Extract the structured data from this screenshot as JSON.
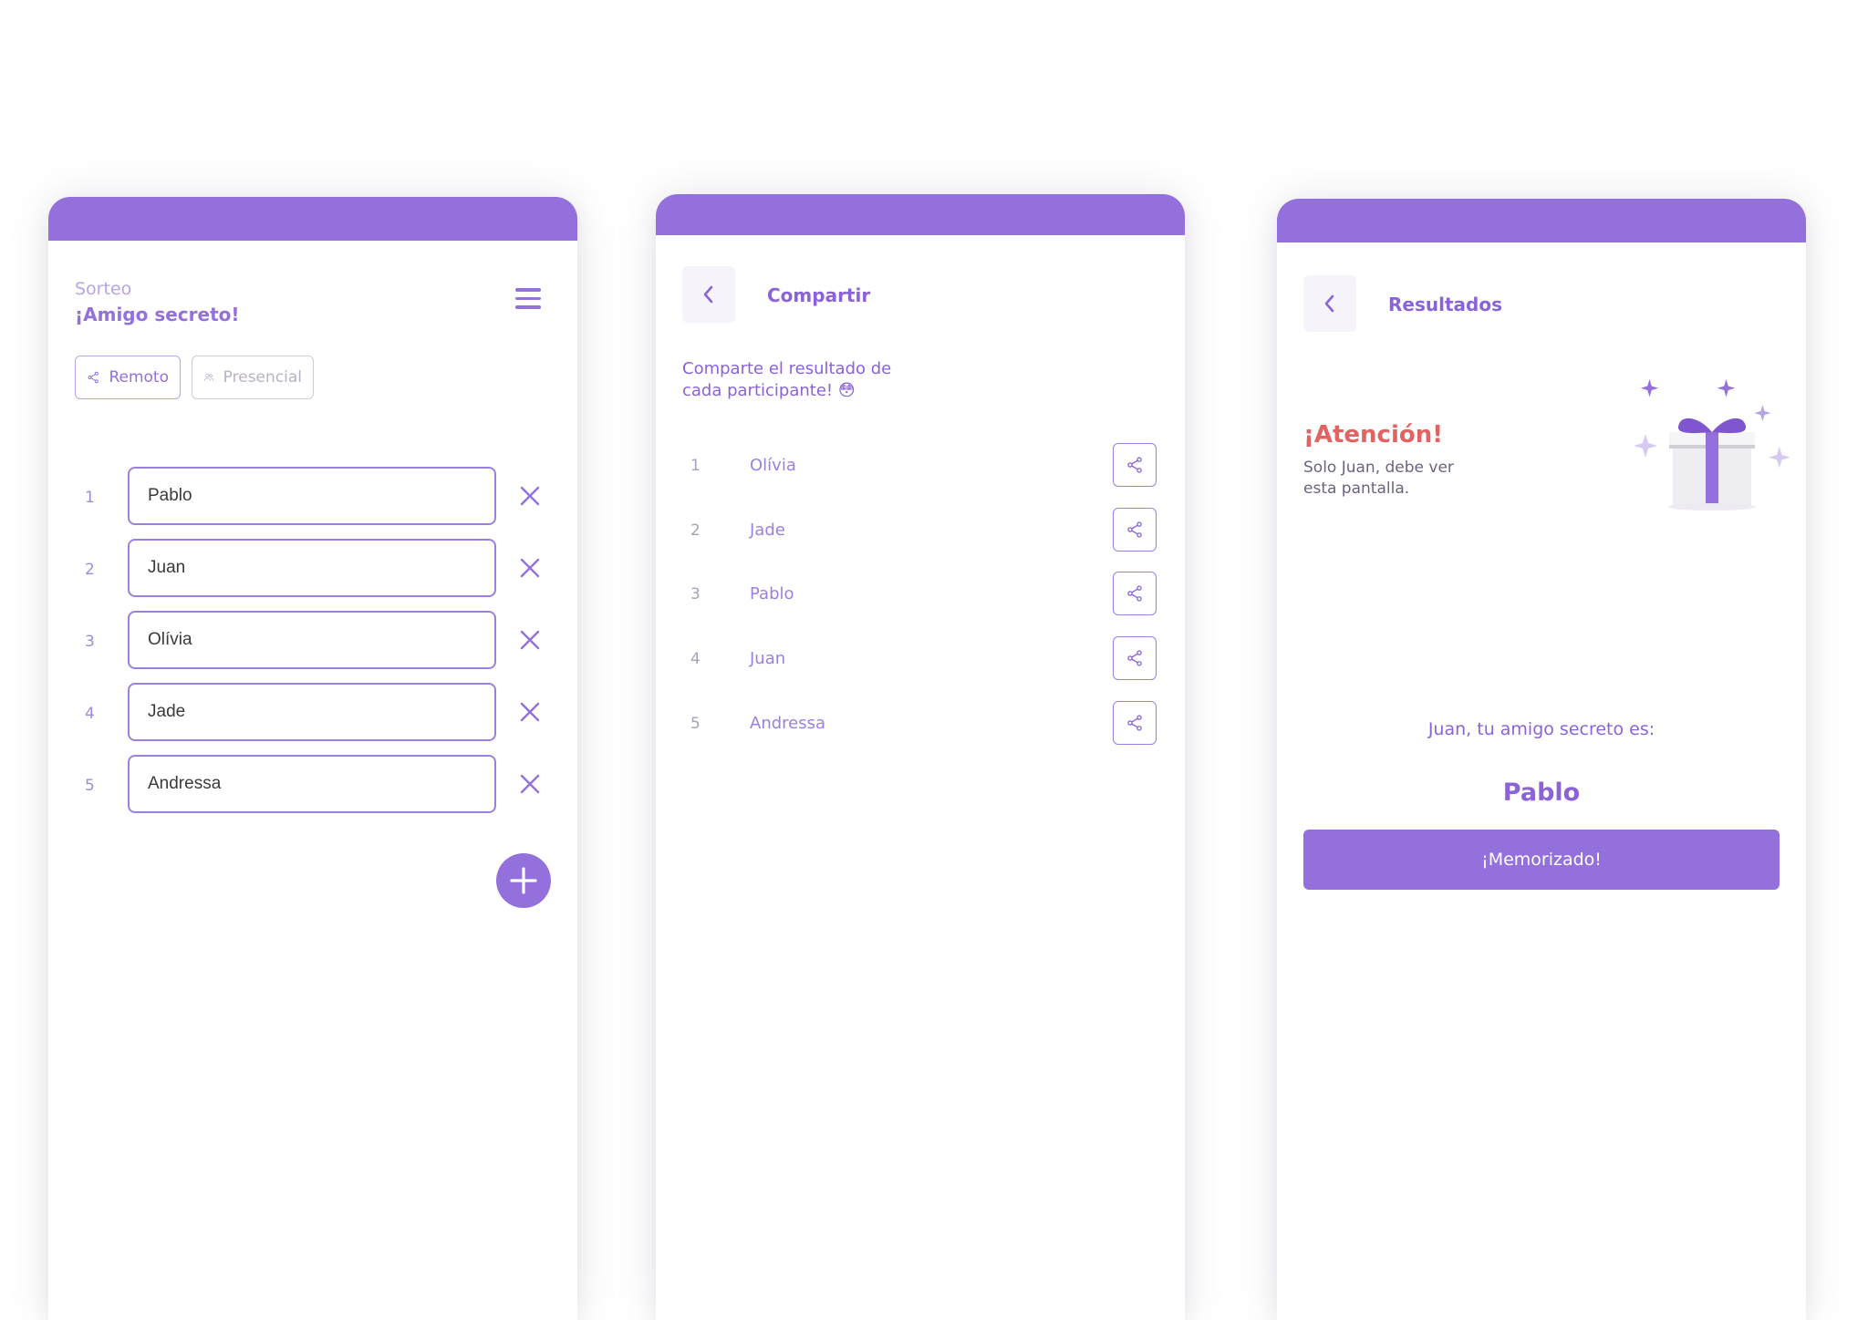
{
  "screen1": {
    "title_small": "Sorteo",
    "title": "¡Amigo secreto!",
    "menu_icon": "hamburger-menu-icon",
    "chips": [
      {
        "label": "Remoto",
        "icon": "share-icon"
      },
      {
        "label": "Presencial",
        "icon": "users-icon"
      }
    ],
    "participants": [
      {
        "num": "1",
        "value": "Pablo"
      },
      {
        "num": "2",
        "value": "Juan"
      },
      {
        "num": "3",
        "value": "Olívia"
      },
      {
        "num": "4",
        "value": "Jade"
      },
      {
        "num": "5",
        "value": "Andressa"
      }
    ],
    "add_icon": "plus-icon"
  },
  "screen2": {
    "title": "Compartir",
    "description": "Comparte el resultado de cada participante! 😳",
    "participants": [
      {
        "num": "1",
        "name": "Olívia"
      },
      {
        "num": "2",
        "name": "Jade"
      },
      {
        "num": "3",
        "name": "Pablo"
      },
      {
        "num": "4",
        "name": "Juan"
      },
      {
        "num": "5",
        "name": "Andressa"
      }
    ]
  },
  "screen3": {
    "title": "Resultados",
    "alert_title": "¡Atención!",
    "alert_text": "Solo Juan, debe ver esta pantalla.",
    "friend_label": "Juan, tu amigo secreto es:",
    "friend_name": "Pablo",
    "button_label": "¡Memorizado!",
    "illustration": "gift-box-icon"
  },
  "colors": {
    "primary": "#9370DB",
    "alert": "#E36262",
    "muted": "#B9A4E6"
  }
}
